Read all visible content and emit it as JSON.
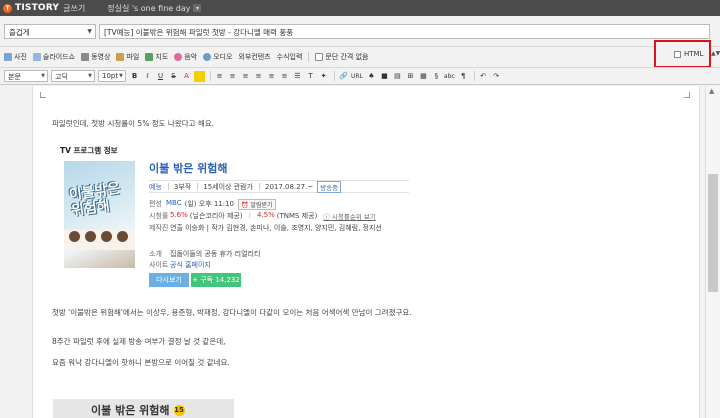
{
  "topbar": {
    "logo_letter": "T",
    "logo": "TISTORY",
    "section": "글쓰기",
    "blog_name": "정실실 's one fine day",
    "drop": "▾"
  },
  "editor_header": {
    "category": "즐겁게",
    "title": "[TV예능] 이불밖은 위험해 파일럿 첫방 - 강다니엘 매력 풍풍"
  },
  "toolbar1": {
    "items": [
      "사진",
      "슬라이드쇼",
      "동영상",
      "파일",
      "지도",
      "음악",
      "오디오",
      "외부컨텐츠",
      "수식입력",
      "문단 간격 없음"
    ],
    "html_label": "HTML",
    "scroll_hint": "▲▼"
  },
  "toolbar2": {
    "style": "본문",
    "font": "고딕",
    "size": "10pt",
    "url_label": "URL",
    "bold": "B",
    "italic": "I",
    "underline": "U",
    "strike": "S",
    "color": "A",
    "misc": [
      "≡",
      "≡",
      "≡",
      "≡",
      "≡",
      "≡",
      "☰",
      "T",
      "✦",
      "🔗",
      "♠",
      "■",
      "▤",
      "⊞",
      "▦",
      "§",
      "abc",
      "¶",
      "↶",
      "↷"
    ]
  },
  "content": {
    "para1": "파일럿인데, 첫방 시청률이 5% 정도 나왔다고 해요.",
    "tv_section_title": "TV 프로그램 정보",
    "poster_text": "이불밖은 위험해",
    "show_name": "이불 밖은 위험해",
    "genre": "예능",
    "episodes": "3부작",
    "rating": "15세이상 관람가",
    "air_date": "2017.08.27.~",
    "status": "방송중",
    "schedule_k": "편성",
    "channel": "MBC",
    "schedule": "(일) 오후 11:10",
    "alarm": "알림받기",
    "ratings_k": "시청률",
    "rate1": "5.6%",
    "rate1_src": "(닐슨코리아 제공)",
    "sep": "|",
    "rate2": "4.5%",
    "rate2_src": "(TNMS 제공)",
    "ratings_link": "시청률순위 보기",
    "crew_k": "제작진",
    "crew": "연출 이승화  |  작가 김현경, 손미나, 이솔, 조영지, 양지민, 김혜림, 정지선",
    "intro_k": "소개",
    "intro": "집돌이들의 공동 휴가 리얼리티",
    "site_k": "사이트",
    "site": "공식 홈페이지",
    "watch_btn": "다시보기",
    "subscribe_btn": "+ 구독 14,232",
    "para2": "첫방 '이불밖은 위험해'에서는 이상우, 용준형, 박재정, 강다니엘이 다같이 모이는 처음 어색어색 만남이 그려졌구요.",
    "para3": "8주간 파일럿 후에 실제 방송 여부가 결정 날 것 같은데,",
    "para4": "요즘 워낙 강다니엘이 핫하니 본방으로 이어질 것 같네요.",
    "box_title": "이불 밖은 위험해",
    "box_num": "15"
  },
  "colors": {
    "accent_blue": "#2b5fb4",
    "highlight_red": "#d9141b",
    "watch_blue": "#6ab0e5",
    "subscribe_green": "#41c57b"
  }
}
